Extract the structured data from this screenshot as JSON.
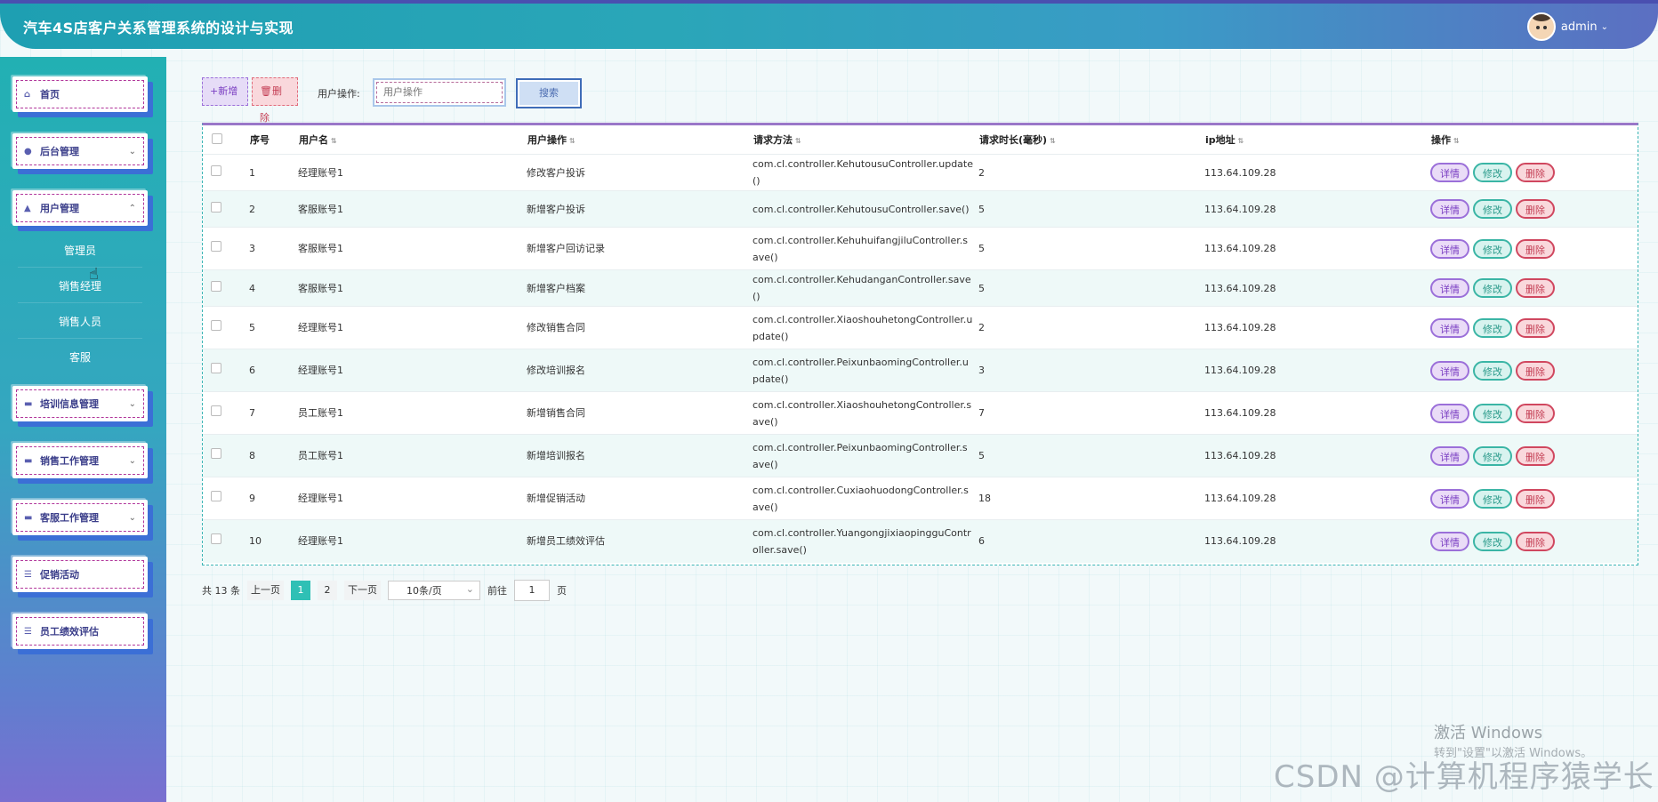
{
  "app": {
    "title": "汽车4S店客户关系管理系统的设计与实现",
    "user": "admin"
  },
  "sidebar": {
    "items": [
      {
        "label": "首页",
        "icon": "home-icon"
      },
      {
        "label": "后台管理",
        "icon": "circle-icon"
      },
      {
        "label": "用户管理",
        "icon": "user-icon"
      },
      {
        "label": "培训信息管理",
        "icon": "book-icon"
      },
      {
        "label": "销售工作管理",
        "icon": "book-icon"
      },
      {
        "label": "客服工作管理",
        "icon": "folder-icon"
      },
      {
        "label": "促销活动",
        "icon": "list-icon"
      },
      {
        "label": "员工绩效评估",
        "icon": "list-icon"
      }
    ],
    "sub_items": [
      "管理员",
      "销售经理",
      "销售人员",
      "客服"
    ]
  },
  "toolbar": {
    "add_label": "+新增",
    "delete_label": "删除",
    "search_label": "用户操作:",
    "search_placeholder": "用户操作",
    "search_button": "搜索"
  },
  "table": {
    "headers": [
      "序号",
      "用户名",
      "用户操作",
      "请求方法",
      "请求时长(毫秒)",
      "ip地址",
      "操作"
    ],
    "actions": {
      "detail": "详情",
      "edit": "修改",
      "delete": "删除"
    },
    "rows": [
      {
        "no": "1",
        "user": "经理账号1",
        "op": "修改客户投诉",
        "method": "com.cl.controller.KehutousuController.update()",
        "ms": "2",
        "ip": "113.64.109.28"
      },
      {
        "no": "2",
        "user": "客服账号1",
        "op": "新增客户投诉",
        "method": "com.cl.controller.KehutousuController.save()",
        "ms": "5",
        "ip": "113.64.109.28"
      },
      {
        "no": "3",
        "user": "客服账号1",
        "op": "新增客户回访记录",
        "method": "com.cl.controller.KehuhuifangjiluController.save()",
        "ms": "5",
        "ip": "113.64.109.28"
      },
      {
        "no": "4",
        "user": "客服账号1",
        "op": "新增客户档案",
        "method": "com.cl.controller.KehudanganController.save()",
        "ms": "5",
        "ip": "113.64.109.28"
      },
      {
        "no": "5",
        "user": "经理账号1",
        "op": "修改销售合同",
        "method": "com.cl.controller.XiaoshouhetongController.update()",
        "ms": "2",
        "ip": "113.64.109.28"
      },
      {
        "no": "6",
        "user": "经理账号1",
        "op": "修改培训报名",
        "method": "com.cl.controller.PeixunbaomingController.update()",
        "ms": "3",
        "ip": "113.64.109.28"
      },
      {
        "no": "7",
        "user": "员工账号1",
        "op": "新增销售合同",
        "method": "com.cl.controller.XiaoshouhetongController.save()",
        "ms": "7",
        "ip": "113.64.109.28"
      },
      {
        "no": "8",
        "user": "员工账号1",
        "op": "新增培训报名",
        "method": "com.cl.controller.PeixunbaomingController.save()",
        "ms": "5",
        "ip": "113.64.109.28"
      },
      {
        "no": "9",
        "user": "经理账号1",
        "op": "新增促销活动",
        "method": "com.cl.controller.CuxiaohuodongController.save()",
        "ms": "18",
        "ip": "113.64.109.28"
      },
      {
        "no": "10",
        "user": "经理账号1",
        "op": "新增员工绩效评估",
        "method": "com.cl.controller.YuangongjixiaopingguController.save()",
        "ms": "6",
        "ip": "113.64.109.28"
      }
    ]
  },
  "pagination": {
    "total": "共 13 条",
    "prev": "上一页",
    "pages": [
      "1",
      "2"
    ],
    "current": "1",
    "next": "下一页",
    "page_size": "10条/页",
    "goto_label": "前往",
    "goto_value": "1",
    "page_unit": "页"
  },
  "watermark": {
    "activate": "激活 Windows",
    "activate_hint": "转到\"设置\"以激活 Windows。",
    "csdn": "CSDN @计算机程序猿学长"
  }
}
